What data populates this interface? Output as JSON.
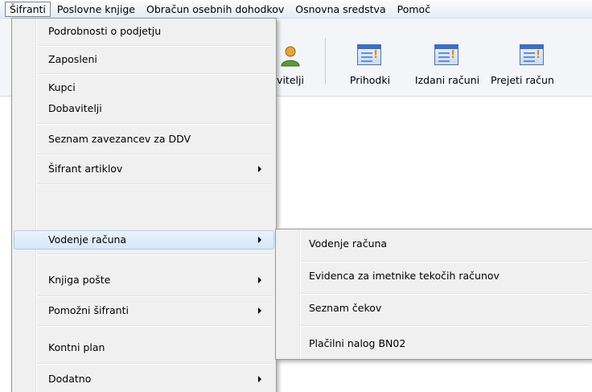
{
  "menubar": {
    "items": [
      {
        "label": "Šifranti"
      },
      {
        "label": "Poslovne knjige"
      },
      {
        "label": "Obračun osebnih dohodkov"
      },
      {
        "label": "Osnovna sredstva"
      },
      {
        "label": "Pomoč"
      }
    ]
  },
  "toolbar": {
    "buttons": [
      {
        "label": "vitelji",
        "icon": "person-icon"
      },
      {
        "label": "Prihodki",
        "icon": "document-icon"
      },
      {
        "label": "Izdani računi",
        "icon": "document-icon"
      },
      {
        "label": "Prejeti račun",
        "icon": "document-icon"
      }
    ]
  },
  "menu": {
    "items": [
      {
        "label": "Podrobnosti o podjetju",
        "submenu": false
      },
      {
        "label": "Zaposleni",
        "submenu": false
      },
      {
        "label": "Kupci",
        "submenu": false
      },
      {
        "label": "Dobavitelji",
        "submenu": false
      },
      {
        "label": "Seznam zavezancev za DDV",
        "submenu": false
      },
      {
        "label": "Šifrant artiklov",
        "submenu": true
      },
      {
        "label": "Vodenje računa",
        "submenu": true,
        "highlighted": true
      },
      {
        "label": "Knjiga pošte",
        "submenu": true
      },
      {
        "label": "Pomožni šifranti",
        "submenu": true
      },
      {
        "label": "Kontni plan",
        "submenu": false
      },
      {
        "label": "Dodatno",
        "submenu": true
      }
    ]
  },
  "submenu": {
    "items": [
      {
        "label": "Vodenje računa"
      },
      {
        "label": "Evidenca za imetnike tekočih računov"
      },
      {
        "label": "Seznam čekov"
      },
      {
        "label": "Plačilni nalog BN02"
      }
    ]
  },
  "colors": {
    "highlight_bg": "#d6e8f8",
    "highlight_border": "#a8cdef",
    "menu_bg": "#f0f0f0",
    "toolbar_bg": "#f3f5f8"
  }
}
